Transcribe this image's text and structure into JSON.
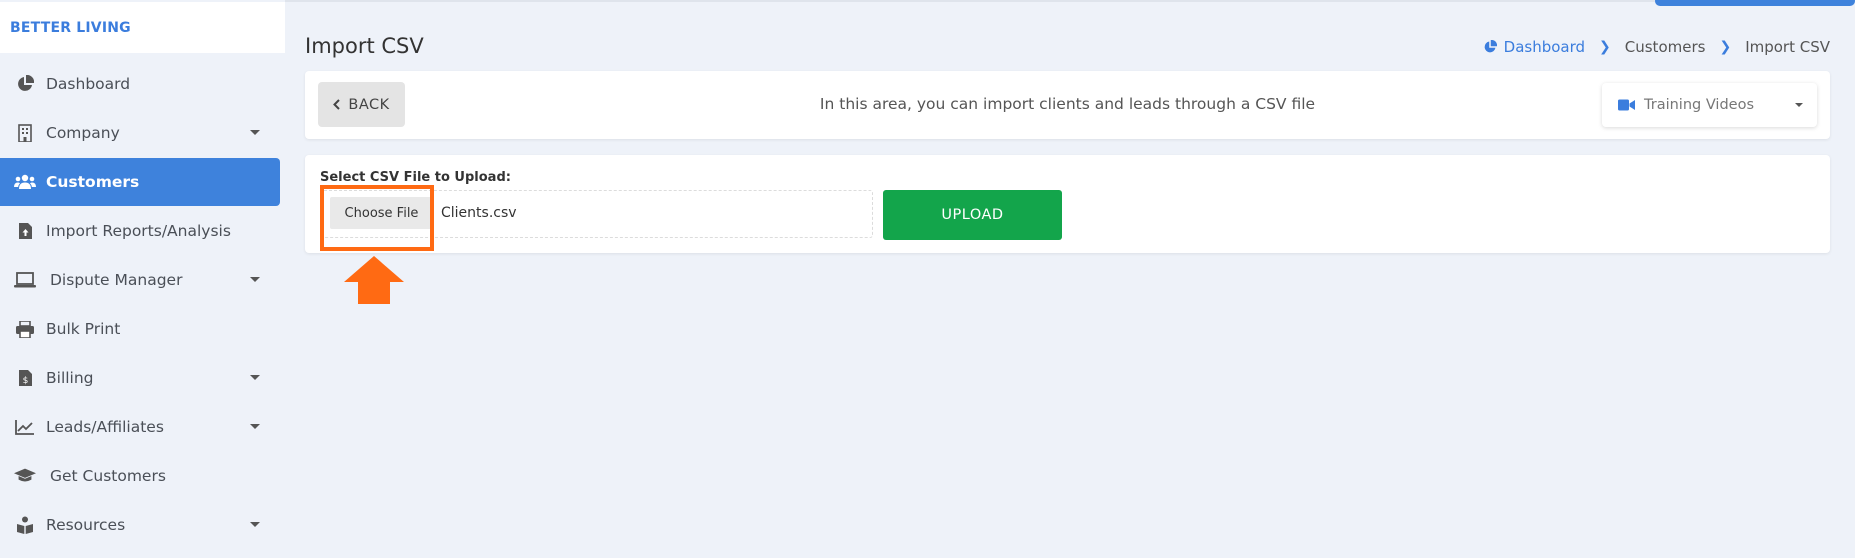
{
  "brand": "BETTER LIVING",
  "sidebar": {
    "items": [
      {
        "label": "Dashboard",
        "icon": "pie-chart-icon",
        "active": false,
        "has_caret": false
      },
      {
        "label": "Company",
        "icon": "building-icon",
        "active": false,
        "has_caret": true
      },
      {
        "label": "Customers",
        "icon": "users-icon",
        "active": true,
        "has_caret": false
      },
      {
        "label": "Import Reports/Analysis",
        "icon": "file-upload-icon",
        "active": false,
        "has_caret": false
      },
      {
        "label": "Dispute Manager",
        "icon": "laptop-icon",
        "active": false,
        "has_caret": true
      },
      {
        "label": "Bulk Print",
        "icon": "printer-icon",
        "active": false,
        "has_caret": false
      },
      {
        "label": "Billing",
        "icon": "invoice-icon",
        "active": false,
        "has_caret": true
      },
      {
        "label": "Leads/Affiliates",
        "icon": "line-chart-icon",
        "active": false,
        "has_caret": true
      },
      {
        "label": "Get Customers",
        "icon": "graduation-cap-icon",
        "active": false,
        "has_caret": false
      },
      {
        "label": "Resources",
        "icon": "book-reader-icon",
        "active": false,
        "has_caret": true
      }
    ]
  },
  "header": {
    "title": "Import CSV",
    "breadcrumb": [
      "Dashboard",
      "Customers",
      "Import CSV"
    ]
  },
  "toolbar": {
    "back_label": "BACK",
    "info_text": "In this area, you can import clients and leads through a CSV file",
    "training_label": "Training Videos"
  },
  "upload": {
    "label": "Select CSV File to Upload:",
    "choose_label": "Choose File",
    "file_name": "Clients.csv",
    "upload_label": "UPLOAD"
  },
  "colors": {
    "accent": "#3e82dc",
    "upload_green": "#13a54b",
    "highlight_orange": "#ff6a13"
  }
}
